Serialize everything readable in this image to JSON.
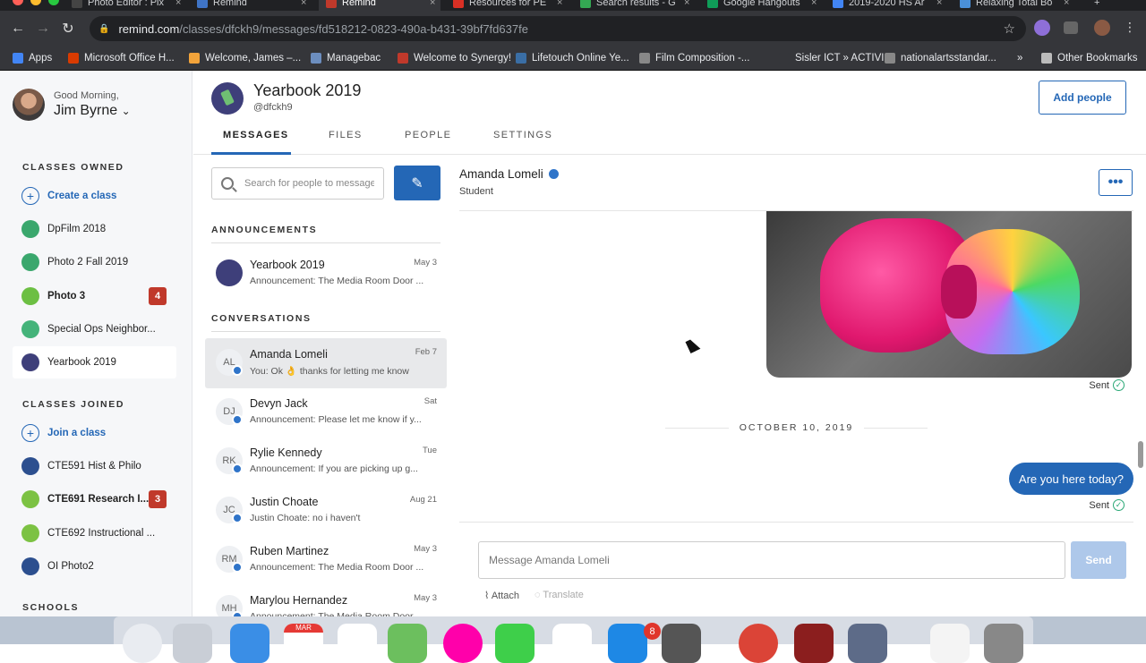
{
  "browser": {
    "tabs": [
      {
        "title": "Photo Editor : Pix",
        "fav": "#444",
        "active": false
      },
      {
        "title": "Remind",
        "fav": "#3f74c6",
        "active": false
      },
      {
        "title": "Remind",
        "fav": "#c0392b",
        "active": true
      },
      {
        "title": "Resources for PE",
        "fav": "#d93025",
        "active": false
      },
      {
        "title": "Search results - G",
        "fav": "#34a853",
        "active": false
      },
      {
        "title": "Google Hangouts",
        "fav": "#0f9d58",
        "active": false
      },
      {
        "title": "2019-2020 HS Ar",
        "fav": "#4285f4",
        "active": false
      },
      {
        "title": "Relaxing Total Bo",
        "fav": "#4a90d9",
        "active": false
      }
    ],
    "new_tab": "+",
    "url_domain": "remind.com",
    "url_path": "/classes/dfckh9/messages/fd518212-0823-490a-b431-39bf7fd637fe",
    "bookmarks": [
      {
        "label": "Apps",
        "color": "#4285f4"
      },
      {
        "label": "Microsoft Office H...",
        "color": "#d83b01"
      },
      {
        "label": "Welcome, James –...",
        "color": "#f2a33a"
      },
      {
        "label": "Managebac",
        "color": "#6c8ebf"
      },
      {
        "label": "Welcome to Synergy!",
        "color": "#c0392b"
      },
      {
        "label": "Lifetouch Online Ye...",
        "color": "#3a6ea5"
      },
      {
        "label": "Film Composition -...",
        "color": "#888"
      },
      {
        "label": "Sisler ICT » ACTIVI...",
        "color": "#35363a"
      },
      {
        "label": "nationalartsstandar...",
        "color": "#888"
      }
    ],
    "overflow": "»",
    "other_bookmarks": "Other Bookmarks"
  },
  "sidebar": {
    "greeting": "Good Morning,",
    "user_name": "Jim Byrne",
    "owned_header": "CLASSES OWNED",
    "create_class": "Create a class",
    "owned": [
      {
        "name": "DpFilm 2018",
        "color": "#3aa76d",
        "badge": "",
        "bold": false,
        "selected": false
      },
      {
        "name": "Photo 2 Fall 2019",
        "color": "#3aa76d",
        "badge": "",
        "bold": false,
        "selected": false
      },
      {
        "name": "Photo 3",
        "color": "#6cbf43",
        "badge": "4",
        "bold": true,
        "selected": false
      },
      {
        "name": "Special Ops Neighbor...",
        "color": "#44b37a",
        "badge": "",
        "bold": false,
        "selected": false
      },
      {
        "name": "Yearbook 2019",
        "color": "#3e3f7a",
        "badge": "",
        "bold": false,
        "selected": true
      }
    ],
    "joined_header": "CLASSES JOINED",
    "join_class": "Join a class",
    "joined": [
      {
        "name": "CTE591 Hist & Philo",
        "color": "#2c4f8f",
        "badge": "",
        "bold": false
      },
      {
        "name": "CTE691 Research I...",
        "color": "#7cc243",
        "badge": "3",
        "bold": true
      },
      {
        "name": "CTE692 Instructional ...",
        "color": "#7cc243",
        "badge": "",
        "bold": false
      },
      {
        "name": "OI Photo2",
        "color": "#2c4f8f",
        "badge": "",
        "bold": false
      }
    ],
    "schools_header": "SCHOOLS"
  },
  "header": {
    "class_title": "Yearbook 2019",
    "class_handle": "@dfckh9",
    "add_people": "Add people",
    "tabs": [
      "MESSAGES",
      "FILES",
      "PEOPLE",
      "SETTINGS"
    ]
  },
  "list": {
    "search_placeholder": "Search for people to message",
    "announcements_header": "ANNOUNCEMENTS",
    "announcement": {
      "name": "Yearbook 2019",
      "date": "May 3",
      "preview": "Announcement: The Media Room Door ..."
    },
    "conversations_header": "CONVERSATIONS",
    "conversations": [
      {
        "initials": "AL",
        "name": "Amanda Lomeli",
        "date": "Feb 7",
        "preview": "You: Ok 👌 thanks for letting me know",
        "selected": true
      },
      {
        "initials": "DJ",
        "name": "Devyn Jack",
        "date": "Sat",
        "preview": "Announcement: Please let me know if y...",
        "selected": false
      },
      {
        "initials": "RK",
        "name": "Rylie Kennedy",
        "date": "Tue",
        "preview": "Announcement: If you are picking up g...",
        "selected": false
      },
      {
        "initials": "JC",
        "name": "Justin Choate",
        "date": "Aug 21",
        "preview": "Justin Choate: no i haven't",
        "selected": false
      },
      {
        "initials": "RM",
        "name": "Ruben Martinez",
        "date": "May 3",
        "preview": "Announcement: The Media Room Door ...",
        "selected": false
      },
      {
        "initials": "MH",
        "name": "Marylou Hernandez",
        "date": "May 3",
        "preview": "Announcement: The Media Room Door ...",
        "selected": false
      }
    ]
  },
  "thread": {
    "name": "Amanda Lomeli",
    "role": "Student",
    "more": "•••",
    "sent_label": "Sent",
    "date_separator": "OCTOBER 10, 2019",
    "bubble": "Are you here today?",
    "message_placeholder": "Message Amanda Lomeli",
    "send": "Send",
    "attach": "Attach",
    "translate": "Translate"
  },
  "dock": {
    "messages_badge": "8",
    "calendar_month": "MAR"
  }
}
